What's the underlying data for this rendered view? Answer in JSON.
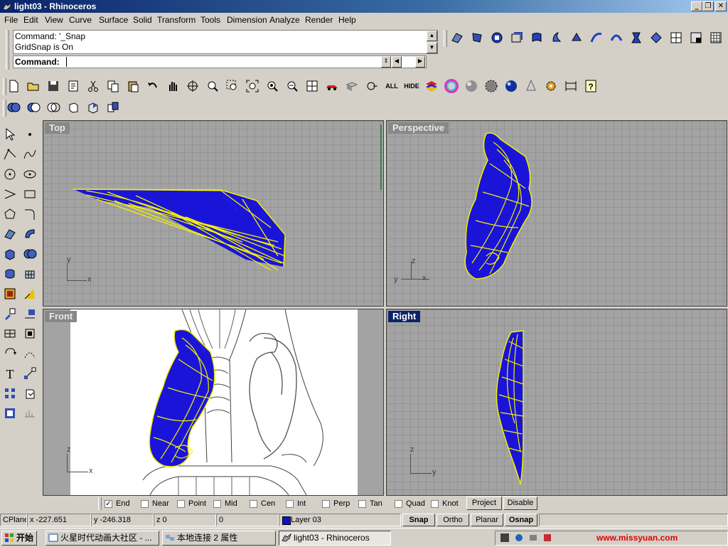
{
  "window": {
    "title": "light03 - Rhinoceros"
  },
  "menu": [
    "File",
    "Edit",
    "View",
    "Curve",
    "Surface",
    "Solid",
    "Transform",
    "Tools",
    "Dimension",
    "Analyze",
    "Render",
    "Help"
  ],
  "command": {
    "history": [
      "Command: '_Snap",
      "GridSnap is On"
    ],
    "prompt_label": "Command:",
    "value": ""
  },
  "standard_toolbar": {
    "all_label": "ALL",
    "hide_label": "HIDE"
  },
  "viewports": {
    "top": "Top",
    "perspective": "Perspective",
    "front": "Front",
    "right": "Right"
  },
  "axis_labels": {
    "x": "x",
    "y": "y",
    "z": "z"
  },
  "osnaps": [
    {
      "label": "End",
      "checked": true
    },
    {
      "label": "Near",
      "checked": false
    },
    {
      "label": "Point",
      "checked": false
    },
    {
      "label": "Mid",
      "checked": false
    },
    {
      "label": "Cen",
      "checked": false
    },
    {
      "label": "Int",
      "checked": false
    },
    {
      "label": "Perp",
      "checked": false
    },
    {
      "label": "Tan",
      "checked": false
    },
    {
      "label": "Quad",
      "checked": false
    },
    {
      "label": "Knot",
      "checked": false
    }
  ],
  "osnap_buttons": {
    "project": "Project",
    "disable": "Disable"
  },
  "status": {
    "cplane": "CPlane",
    "x": "x -227.651",
    "y": "y -246.318",
    "z": "z 0",
    "extra": "0",
    "layer": "Layer 03",
    "layer_color": "#1010d0",
    "snap": "Snap",
    "ortho": "Ortho",
    "planar": "Planar",
    "osnap": "Osnap"
  },
  "taskbar": {
    "start": "开始",
    "tasks": [
      "火星时代动画大社区 - ...",
      "本地连接 2 属性",
      "light03 - Rhinoceros"
    ],
    "tray_text": "www.missyuan.com"
  },
  "colors": {
    "surface": "#1a14d8",
    "wire": "#f0f000",
    "title_active": "#0a246a"
  }
}
